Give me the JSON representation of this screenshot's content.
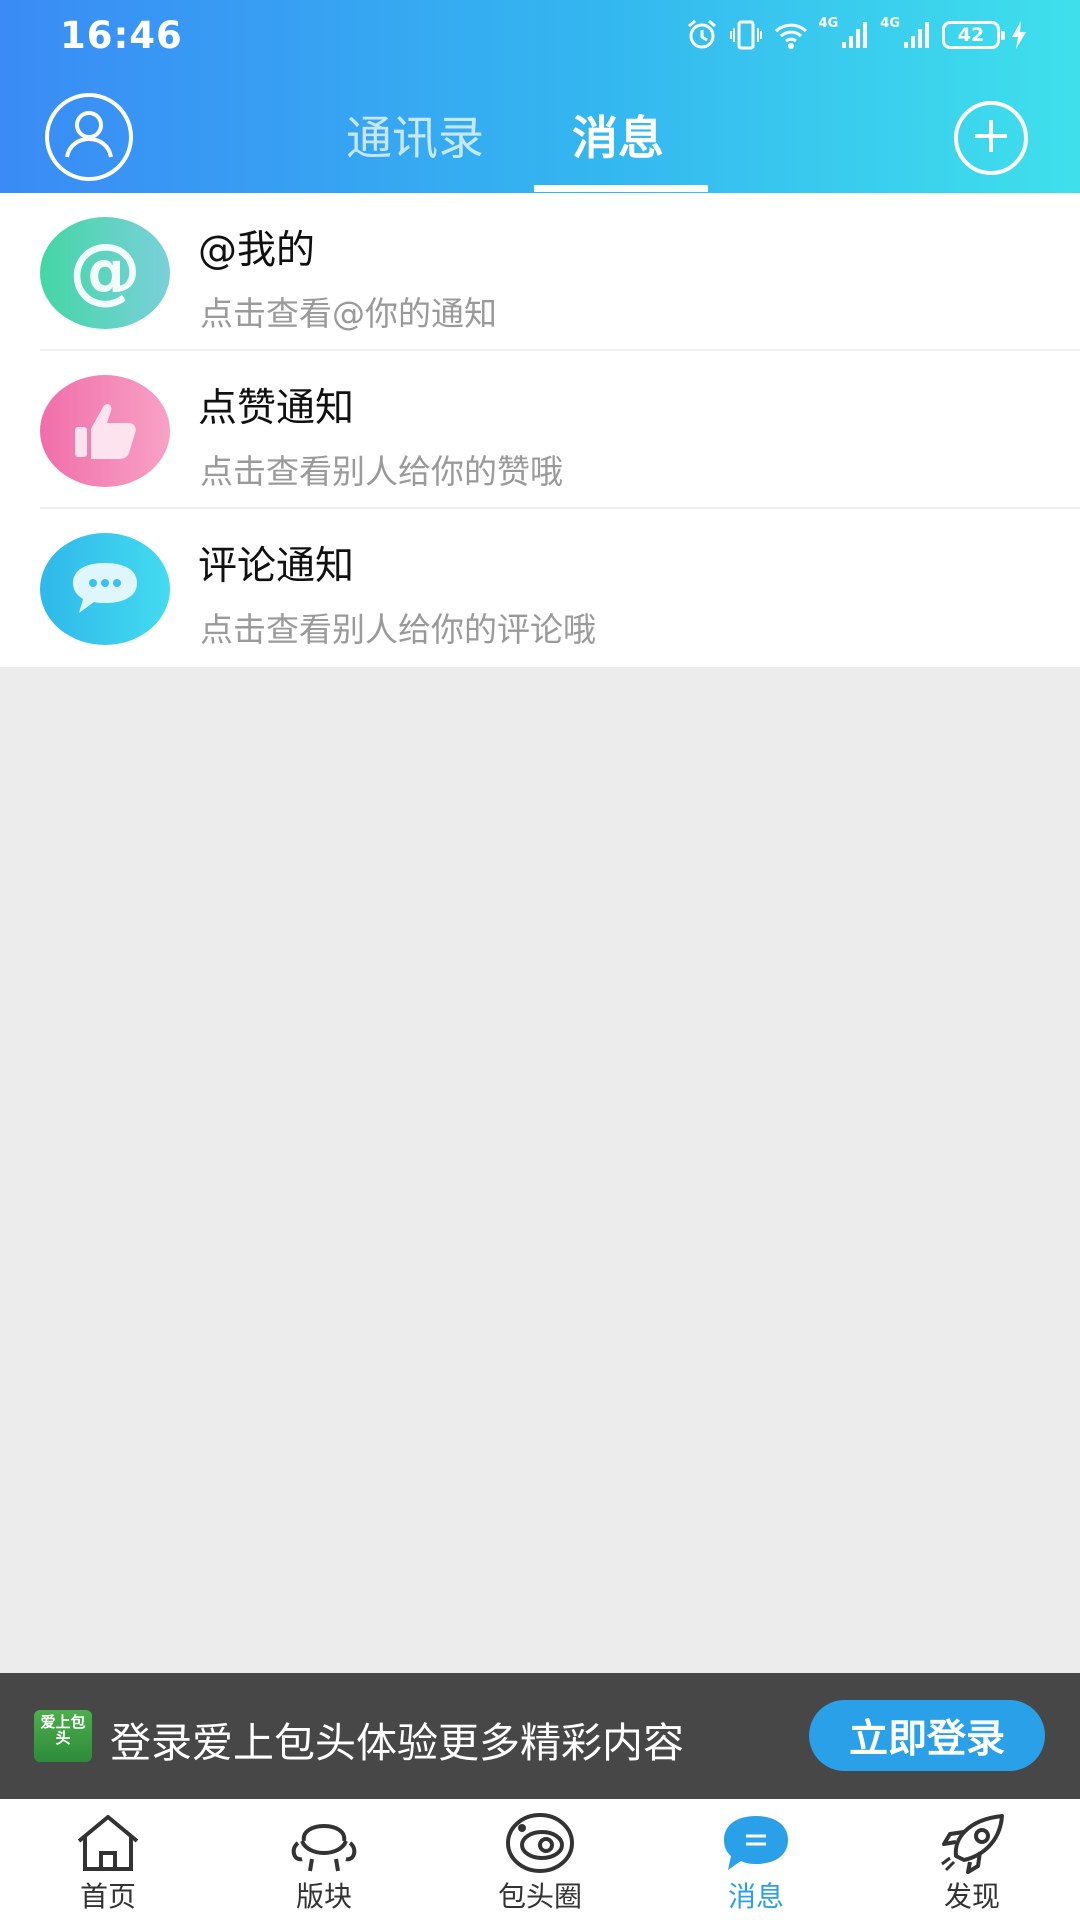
{
  "status_bar": {
    "time": "16:46",
    "battery": "42",
    "network_1": "4G",
    "network_2": "4G",
    "icons": [
      "alarm-icon",
      "vibrate-icon",
      "wifi-icon",
      "signal-icon",
      "signal-icon",
      "battery-icon",
      "charging-icon"
    ]
  },
  "header": {
    "tabs": [
      {
        "label": "通讯录",
        "active": false
      },
      {
        "label": "消息",
        "active": true
      }
    ],
    "avatar_icon": "user-icon",
    "add_icon": "plus-icon"
  },
  "notifications": [
    {
      "title": "@我的",
      "subtitle": "点击查看@你的通知",
      "icon": "at-icon",
      "color": "#44d6a4"
    },
    {
      "title": "点赞通知",
      "subtitle": "点击查看别人给你的赞哦",
      "icon": "thumbs-up-icon",
      "color": "#f06ea9"
    },
    {
      "title": "评论通知",
      "subtitle": "点击查看别人给你的评论哦",
      "icon": "comment-icon",
      "color": "#2fb8ea"
    }
  ],
  "login_banner": {
    "logo_text": "爱上包头",
    "text": "登录爱上包头体验更多精彩内容",
    "button_label": "立即登录",
    "button_color": "#2aa0e8"
  },
  "bottom_nav": {
    "items": [
      {
        "label": "首页",
        "icon": "home-icon",
        "active": false
      },
      {
        "label": "版块",
        "icon": "forum-icon",
        "active": false
      },
      {
        "label": "包头圈",
        "icon": "circle-icon",
        "active": false
      },
      {
        "label": "消息",
        "icon": "message-icon",
        "active": true
      },
      {
        "label": "发现",
        "icon": "rocket-icon",
        "active": false
      }
    ],
    "active_color": "#2aa0e8"
  }
}
